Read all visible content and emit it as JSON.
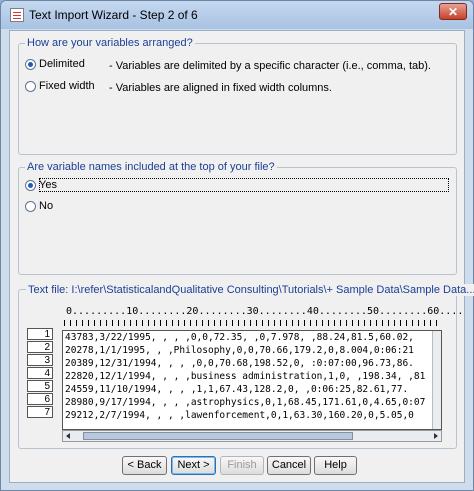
{
  "window": {
    "title": "Text Import Wizard - Step 2 of 6",
    "close_label": "✕"
  },
  "arrangement": {
    "legend": "How are your variables arranged?",
    "delimited": {
      "label": "Delimited",
      "desc": "- Variables are delimited by a specific character (i.e., comma, tab).",
      "selected": true
    },
    "fixed": {
      "label": "Fixed width",
      "desc": "- Variables are aligned in fixed width columns.",
      "selected": false
    }
  },
  "names": {
    "legend": "Are variable names included at the top of your file?",
    "yes": {
      "label": "Yes",
      "selected": true
    },
    "no": {
      "label": "No",
      "selected": false
    }
  },
  "preview": {
    "label": "Text file:  I:\\refer\\StatisticalandQualitative Consulting\\Tutorials\\+ Sample Data\\Sample Data...",
    "ruler": "0.........10........20........30........40........50........60....",
    "row_numbers": [
      "1",
      "2",
      "3",
      "4",
      "5",
      "6",
      "7"
    ],
    "lines": [
      "43783,3/22/1995, , , ,0,0,72.35, ,0,7.978, ,88.24,81.5,60.02,",
      "20278,1/1/1995, , ,Philosophy,0,0,70.66,179.2,0,8.004,0:06:21",
      "20389,12/31/1994, , , ,0,0,70.68,198.52,0, :0:07:00,96.73,86.",
      "22820,12/1/1994, , , ,business administration,1,0, ,198.34, ,81",
      "24559,11/10/1994, , , ,1,1,67.43,128.2,0, ,0:06:25,82.61,77.",
      "28980,9/17/1994, , , ,astrophysics,0,1,68.45,171.61,0,4.65,0:07",
      "29212,2/7/1994, , , ,lawenforcement,0,1,63.30,160.20,0,5.05,0"
    ]
  },
  "buttons": {
    "back": "< Back",
    "next": "Next >",
    "finish": "Finish",
    "cancel": "Cancel",
    "help": "Help"
  }
}
